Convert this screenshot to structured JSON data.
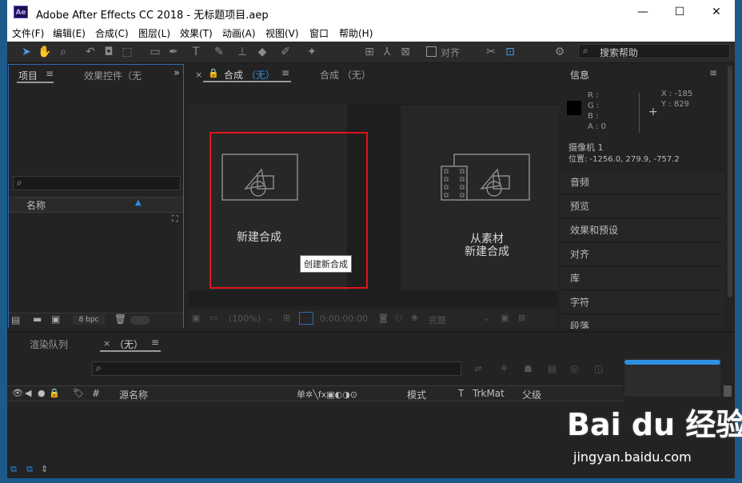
{
  "window": {
    "title": "Adobe After Effects CC 2018 - 无标题项目.aep",
    "app_icon_text": "Ae",
    "controls": {
      "minimize": "—",
      "maximize": "☐",
      "close": "✕"
    }
  },
  "menu": [
    "文件(F)",
    "编辑(E)",
    "合成(C)",
    "图层(L)",
    "效果(T)",
    "动画(A)",
    "视图(V)",
    "窗口",
    "帮助(H)"
  ],
  "toolbar": {
    "align_label": "对齐",
    "search_help_placeholder": "搜索帮助",
    "icons": [
      "selection-tool-icon",
      "hand-tool-icon",
      "zoom-tool-icon",
      "rotate-tool-icon",
      "camera-tool-icon",
      "pan-behind-tool-icon",
      "rectangle-tool-icon",
      "pen-tool-icon",
      "type-tool-icon",
      "brush-tool-icon",
      "clone-stamp-tool-icon",
      "eraser-tool-icon",
      "roto-brush-tool-icon",
      "puppet-tool-icon"
    ]
  },
  "project_panel": {
    "tab_project": "项目",
    "tab_effects": "效果控件（无",
    "column_name": "名称",
    "bpc": "8 bpc"
  },
  "comp_panel": {
    "tab_comp_prefix": "合成",
    "tab_comp_none": "（无）",
    "tab_comp2": "合成 （无）",
    "new_comp_label": "新建合成",
    "tooltip": "创建新合成",
    "footage_line1": "从素材",
    "footage_line2": "新建合成",
    "zoom": "(100%)",
    "timecode": "0:00:00:00",
    "quality": "完整"
  },
  "info_panel": {
    "title": "信息",
    "r": "R :",
    "g": "G :",
    "b": "B :",
    "a": "A :  0",
    "x": "X : -185",
    "y": "Y : 829",
    "camera": "摄像机 1",
    "position": "位置: -1256.0, 279.9, -757.2"
  },
  "right_sections": [
    "音频",
    "预览",
    "效果和预设",
    "对齐",
    "库",
    "字符",
    "段落"
  ],
  "timeline": {
    "tab_render": "渲染队列",
    "tab_none": "（无）",
    "col_source": "源名称",
    "col_mode": "模式",
    "col_t": "T",
    "col_trkmat": "TrkMat",
    "col_parent": "父级",
    "col_hash": "#"
  },
  "watermark": {
    "brand": "Bai du 经验",
    "url": "jingyan.baidu.com"
  },
  "colors": {
    "highlight_border": "#e0141c",
    "accent_blue": "#2f8fe0"
  }
}
